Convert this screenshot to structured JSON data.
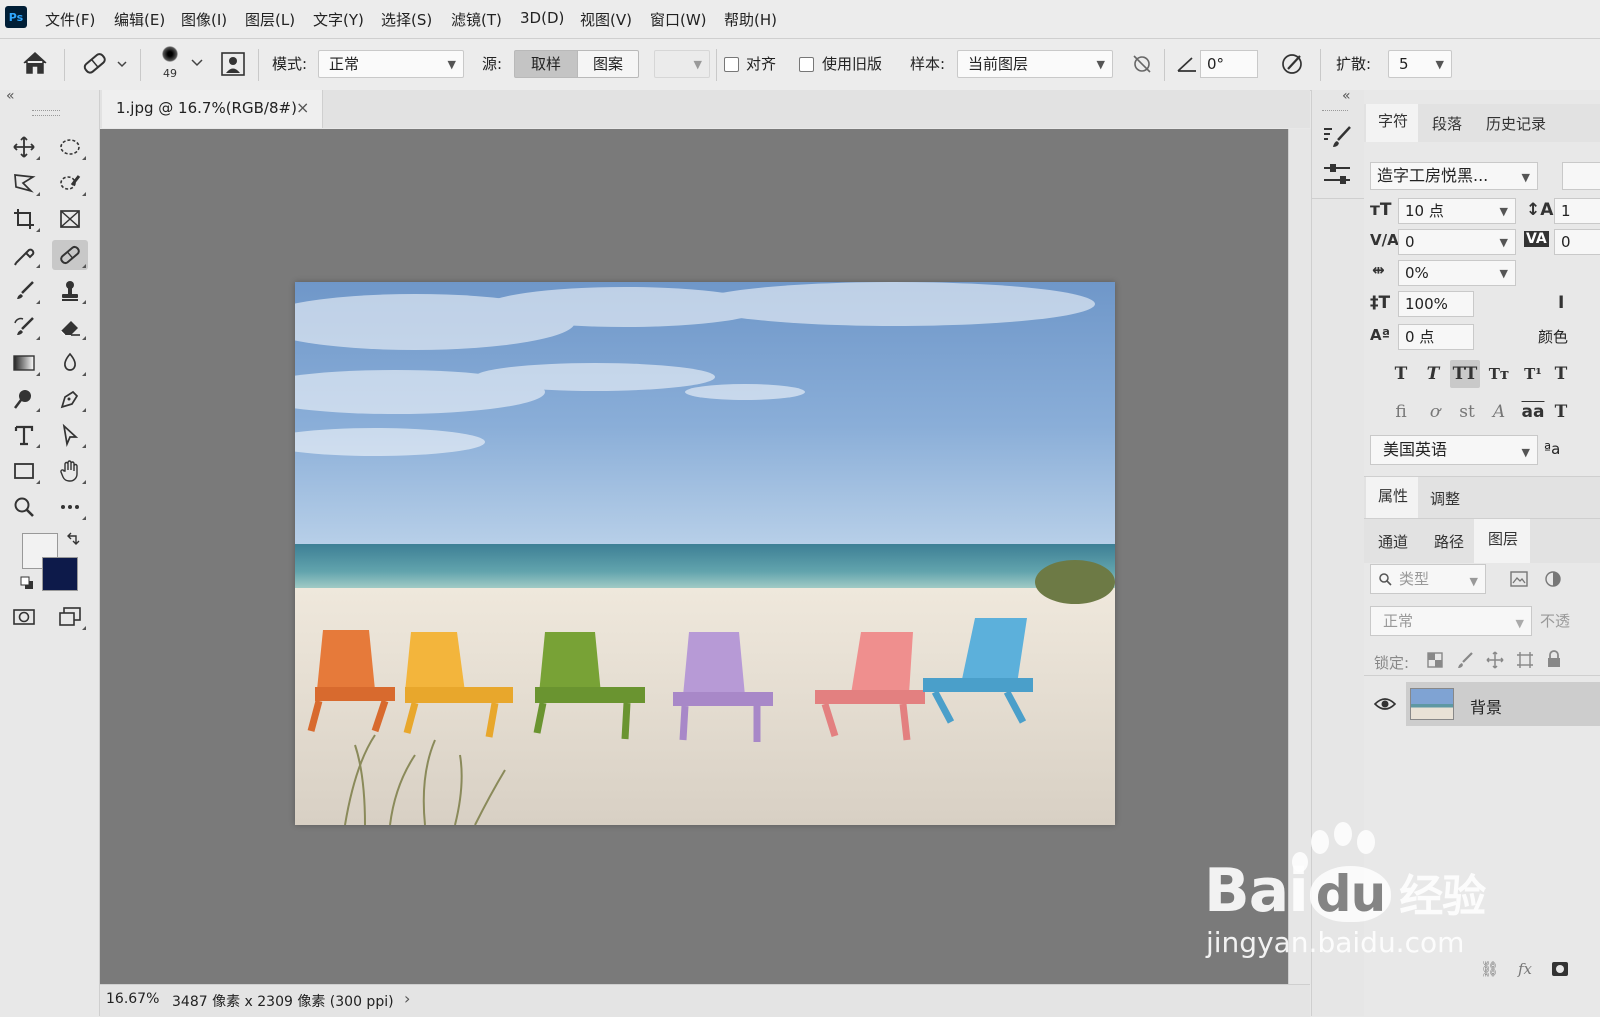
{
  "app": {
    "logo": "Ps"
  },
  "menu": [
    "文件(F)",
    "编辑(E)",
    "图像(I)",
    "图层(L)",
    "文字(Y)",
    "选择(S)",
    "滤镜(T)",
    "3D(D)",
    "视图(V)",
    "窗口(W)",
    "帮助(H)"
  ],
  "options": {
    "brush_size": "49",
    "mode_label": "模式:",
    "mode_value": "正常",
    "source_label": "源:",
    "source_sampled": "取样",
    "source_pattern": "图案",
    "aligned_label": "对齐",
    "legacy_label": "使用旧版",
    "sample_label": "样本:",
    "sample_value": "当前图层",
    "angle_value": "0°",
    "diffusion_label": "扩散:",
    "diffusion_value": "5"
  },
  "document": {
    "tab_title": "1.jpg @ 16.7%(RGB/8#)",
    "close_glyph": "×",
    "status_zoom": "16.67%",
    "status_info": "3487 像素 x 2309 像素 (300 ppi)",
    "status_arrow": "›"
  },
  "panels": {
    "collapse_left": "«",
    "collapse_right": "«",
    "character_tabs": [
      "字符",
      "段落",
      "历史记录"
    ],
    "font_family": "造字工房悦黑...",
    "font_size": "10 点",
    "kerning": "0",
    "tracking_pct": "0%",
    "vertical_scale": "100%",
    "baseline_shift": "0 点",
    "leading_partial": "1",
    "tracking_partial": "0",
    "color_label": "颜色",
    "language": "美国英语",
    "aa_label": "ªa",
    "props_tabs": [
      "属性",
      "调整"
    ],
    "layer_tabs": [
      "通道",
      "路径",
      "图层"
    ],
    "layer_filter": "类型",
    "blend_mode": "正常",
    "opacity_label": "不透",
    "lock_label": "锁定:",
    "layer_name": "背景",
    "bottom_icons": [
      "⛓",
      "fx"
    ]
  },
  "watermark": {
    "brand": "Bai",
    "du": "du",
    "suffix": "经验",
    "url": "jingyan.baidu.com"
  }
}
